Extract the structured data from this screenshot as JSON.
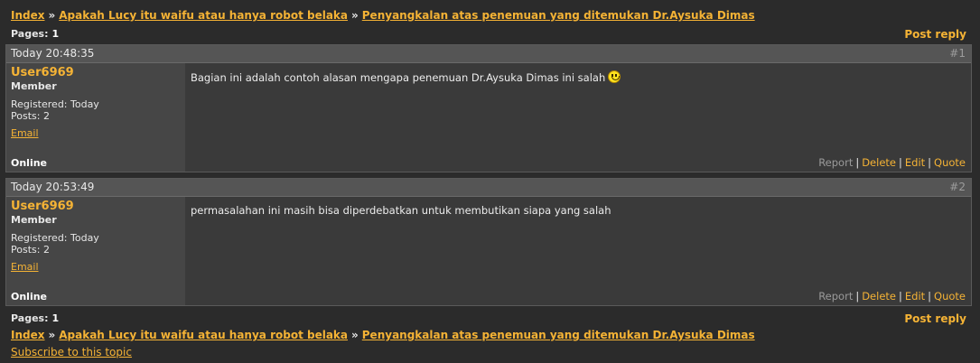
{
  "breadcrumb": {
    "index": "Index",
    "forum": "Apakah Lucy itu waifu atau hanya robot belaka",
    "topic": "Penyangkalan atas penemuan yang ditemukan Dr.Aysuka Dimas",
    "separator": "»"
  },
  "pagination": {
    "label": "Pages:",
    "current": "1"
  },
  "post_reply": "Post reply",
  "posts": [
    {
      "time": "Today 20:48:35",
      "number": "#1",
      "username": "User6969",
      "role": "Member",
      "registered": "Registered: Today",
      "posts_count": "Posts: 2",
      "email": "Email",
      "status": "Online",
      "message": "Bagian ini adalah contoh alasan mengapa penemuan Dr.Aysuka Dimas ini salah",
      "has_smiley": true
    },
    {
      "time": "Today 20:53:49",
      "number": "#2",
      "username": "User6969",
      "role": "Member",
      "registered": "Registered: Today",
      "posts_count": "Posts: 2",
      "email": "Email",
      "status": "Online",
      "message": "permasalahan ini masih bisa diperdebatkan untuk membutikan siapa yang salah",
      "has_smiley": false
    }
  ],
  "actions": {
    "report": "Report",
    "delete": "Delete",
    "edit": "Edit",
    "quote": "Quote",
    "separator": "|"
  },
  "subscribe": "Subscribe to this topic",
  "colors": {
    "link": "#f5b335",
    "background": "#2b2b2b",
    "header_bar": "#555555"
  },
  "icons": {
    "smiley": "smiley-icon"
  }
}
